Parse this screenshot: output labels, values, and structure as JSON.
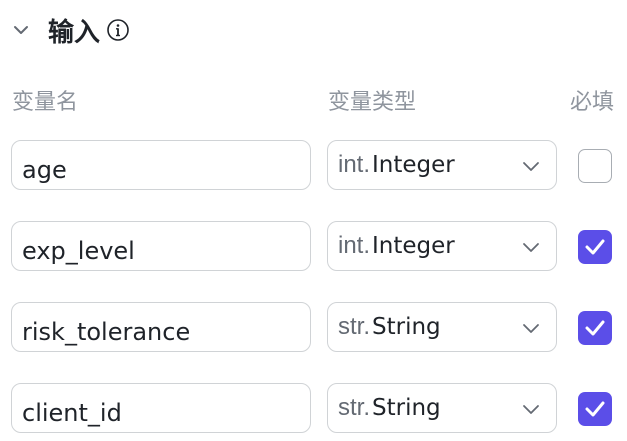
{
  "section": {
    "title": "输入"
  },
  "columns": {
    "name": "变量名",
    "type": "变量类型",
    "required": "必填"
  },
  "rows": [
    {
      "name": "age",
      "type_prefix": "int.",
      "type_label": "Integer",
      "required": false
    },
    {
      "name": "exp_level",
      "type_prefix": "int.",
      "type_label": "Integer",
      "required": true
    },
    {
      "name": "risk_tolerance",
      "type_prefix": "str.",
      "type_label": "String",
      "required": true
    },
    {
      "name": "client_id",
      "type_prefix": "str.",
      "type_label": "String",
      "required": true
    }
  ],
  "colors": {
    "checkbox_on": "#5b4ee8",
    "border": "#d0d3d6",
    "header_text": "#8f959e"
  },
  "icons": {
    "collapse": "chevron-down-icon",
    "info": "info-icon",
    "select": "chevron-down-icon",
    "check": "check-icon"
  }
}
